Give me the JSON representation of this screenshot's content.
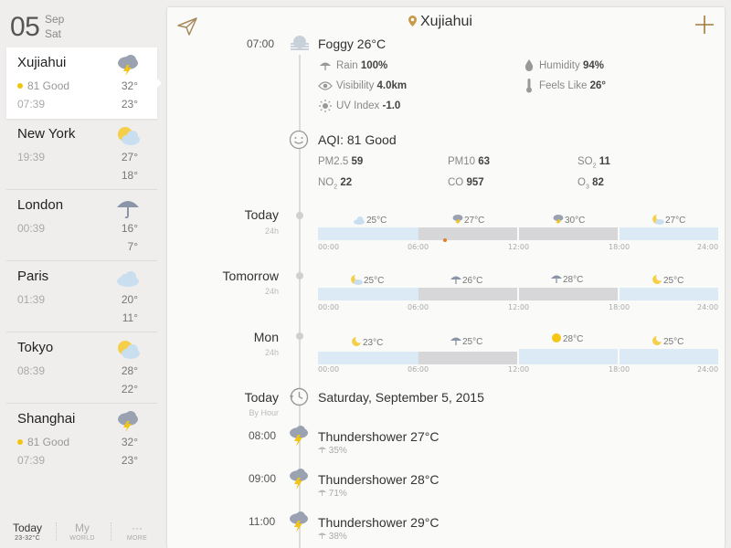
{
  "header": {
    "day": "05",
    "month": "Sep",
    "weekday": "Sat"
  },
  "cities": [
    {
      "name": "Xujiahui",
      "aqi": "81 Good",
      "time": "07:39",
      "high": "32°",
      "low": "23°",
      "icon": "thunder-shower-icon",
      "active": true
    },
    {
      "name": "New York",
      "time": "19:39",
      "high": "27°",
      "low": "18°",
      "icon": "partly-cloudy-icon"
    },
    {
      "name": "London",
      "time": "00:39",
      "high": "16°",
      "low": "7°",
      "icon": "rain-icon"
    },
    {
      "name": "Paris",
      "time": "01:39",
      "high": "20°",
      "low": "11°",
      "icon": "cloudy-icon"
    },
    {
      "name": "Tokyo",
      "time": "08:39",
      "high": "28°",
      "low": "22°",
      "icon": "partly-cloudy-icon"
    },
    {
      "name": "Shanghai",
      "aqi": "81 Good",
      "time": "07:39",
      "high": "32°",
      "low": "23°",
      "icon": "thunder-shower-icon"
    }
  ],
  "tabs": [
    {
      "label": "Today",
      "sub": "23-32°C",
      "active": true
    },
    {
      "label": "My",
      "sub": "WORLD"
    },
    {
      "label": "···",
      "sub": "MORE"
    }
  ],
  "main": {
    "location": "Xujiahui",
    "current": {
      "time": "07:00",
      "condition": "Foggy 26°C",
      "rain_label": "Rain",
      "rain_value": "100%",
      "visibility_label": "Visibility",
      "visibility_value": "4.0km",
      "uv_label": "UV Index",
      "uv_value": "-1.0",
      "humidity_label": "Humidity",
      "humidity_value": "94%",
      "feels_label": "Feels Like",
      "feels_value": "26°"
    },
    "aqi": {
      "title": "AQI: 81 Good",
      "pm25_label": "PM2.5",
      "pm25_value": "59",
      "pm10_label": "PM10",
      "pm10_value": "63",
      "so2_label": "SO",
      "so2_sub": "2",
      "so2_value": "11",
      "no2_label": "NO",
      "no2_sub": "2",
      "no2_value": "22",
      "co_label": "CO",
      "co_value": "957",
      "o3_label": "O",
      "o3_sub": "3",
      "o3_value": "82"
    },
    "days": [
      {
        "label": "Today",
        "sub": "24h",
        "temps": [
          {
            "icon": "cloudy-icon",
            "value": "25°C"
          },
          {
            "icon": "thunder-shower-icon",
            "value": "27°C"
          },
          {
            "icon": "thunder-shower-icon",
            "value": "30°C"
          },
          {
            "icon": "partly-cloudy-night-icon",
            "value": "27°C"
          }
        ],
        "ticks": [
          "00:00",
          "06:00",
          "12:00",
          "18:00",
          "24:00"
        ]
      },
      {
        "label": "Tomorrow",
        "sub": "24h",
        "temps": [
          {
            "icon": "partly-cloudy-night-icon",
            "value": "25°C"
          },
          {
            "icon": "rain-icon",
            "value": "26°C"
          },
          {
            "icon": "rain-icon",
            "value": "28°C"
          },
          {
            "icon": "moon-icon",
            "value": "25°C"
          }
        ],
        "ticks": [
          "00:00",
          "06:00",
          "12:00",
          "18:00",
          "24:00"
        ]
      },
      {
        "label": "Mon",
        "sub": "24h",
        "temps": [
          {
            "icon": "moon-icon",
            "value": "23°C"
          },
          {
            "icon": "rain-icon",
            "value": "25°C"
          },
          {
            "icon": "sun-icon",
            "value": "28°C"
          },
          {
            "icon": "moon-icon",
            "value": "25°C"
          }
        ],
        "ticks": [
          "00:00",
          "06:00",
          "12:00",
          "18:00",
          "24:00"
        ]
      }
    ],
    "hourly_header": {
      "label": "Today",
      "sub": "By Hour",
      "date": "Saturday, September 5, 2015"
    },
    "hourly": [
      {
        "time": "08:00",
        "condition": "Thundershower 27°C",
        "precip": "35%"
      },
      {
        "time": "09:00",
        "condition": "Thundershower 28°C",
        "precip": "71%"
      },
      {
        "time": "11:00",
        "condition": "Thundershower 29°C",
        "precip": "38%"
      }
    ]
  },
  "colors": {
    "bar_light": "#dbeaf4",
    "bar_gray": "#d7d7d9",
    "accent": "#e6a23c",
    "aqi_good": "#f1c40f"
  }
}
